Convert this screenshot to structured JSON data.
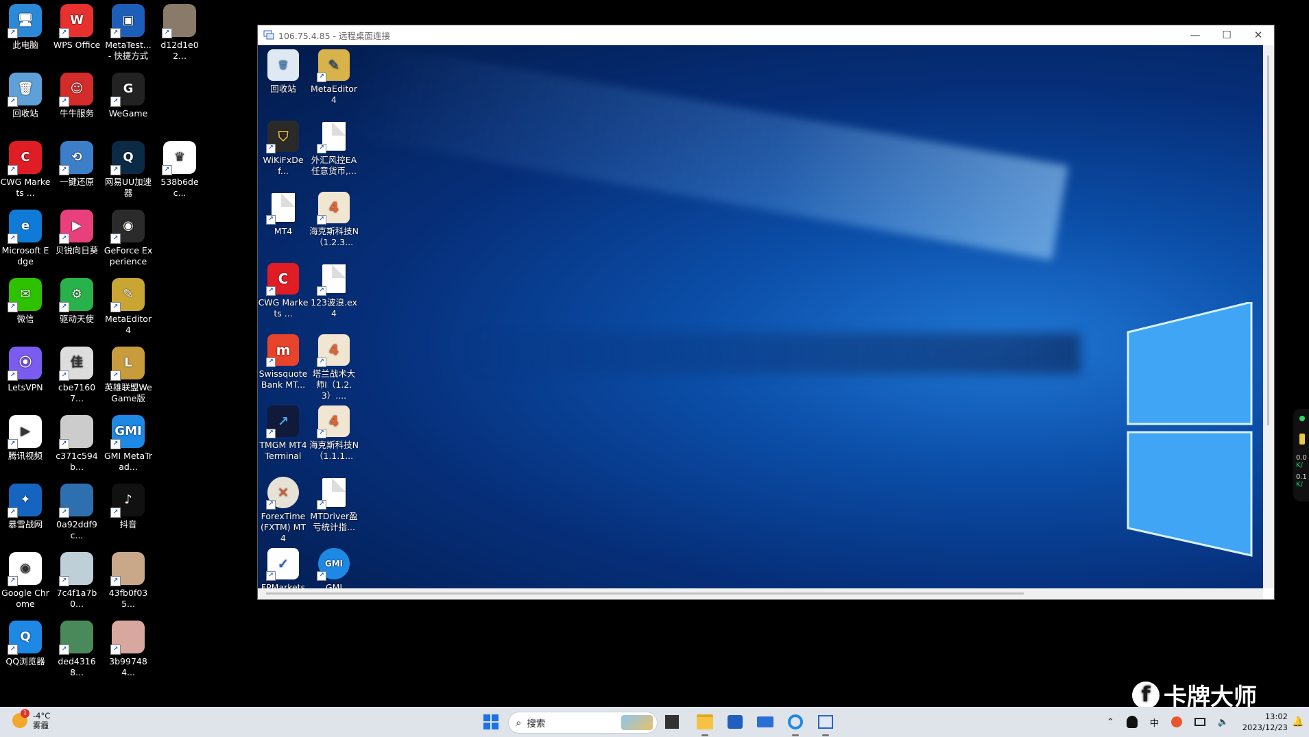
{
  "desktop": {
    "icons": [
      {
        "label": "此电脑",
        "color": "#2a8ad8",
        "glyph": "🖥"
      },
      {
        "label": "WPS Office",
        "color": "#e8302e",
        "glyph": "W"
      },
      {
        "label": "MetaTest... - 快捷方式",
        "color": "#1d5fb8",
        "glyph": "▣"
      },
      {
        "label": "d12d1e02...",
        "color": "#8a7a6a",
        "glyph": ""
      },
      {
        "label": "回收站",
        "color": "#5fa0d8",
        "glyph": "🗑"
      },
      {
        "label": "牛牛服务",
        "color": "#d42b2b",
        "glyph": "☺"
      },
      {
        "label": "WeGame",
        "color": "#222222",
        "glyph": "G"
      },
      {
        "label": "CWG Markets ...",
        "color": "#e01c24",
        "glyph": "C"
      },
      {
        "label": "一键还原",
        "color": "#3c7fc8",
        "glyph": "⟲"
      },
      {
        "label": "网易UU加速器",
        "color": "#0b2a46",
        "glyph": "Q"
      },
      {
        "label": "538b6dec...",
        "color": "#ffffff",
        "glyph": "♛"
      },
      {
        "label": "Microsoft Edge",
        "color": "#0f7bd6",
        "glyph": "e"
      },
      {
        "label": "贝锐向日葵",
        "color": "#e8407c",
        "glyph": "▶"
      },
      {
        "label": "GeForce Experience",
        "color": "#2b2b2b",
        "glyph": "◉"
      },
      {
        "label": "微信",
        "color": "#2dc100",
        "glyph": "✉"
      },
      {
        "label": "驱动天使",
        "color": "#2ab24a",
        "glyph": "⚙"
      },
      {
        "label": "MetaEditor 4",
        "color": "#c9a534",
        "glyph": "✎"
      },
      {
        "label": "LetsVPN",
        "color": "#7b5cf0",
        "glyph": "⦿"
      },
      {
        "label": "cbe71607...",
        "color": "#dddddd",
        "glyph": "佳"
      },
      {
        "label": "英雄联盟WeGame版",
        "color": "#c89b3c",
        "glyph": "L"
      },
      {
        "label": "腾讯视频",
        "color": "#ffffff",
        "glyph": "▶"
      },
      {
        "label": "c371c594b...",
        "color": "#cccccc",
        "glyph": ""
      },
      {
        "label": "GMI MetaTrad...",
        "color": "#1e88e5",
        "glyph": "GMI"
      },
      {
        "label": "暴雪战网",
        "color": "#1565c0",
        "glyph": "✦"
      },
      {
        "label": "0a92ddf9c...",
        "color": "#2e6fb0",
        "glyph": ""
      },
      {
        "label": "抖音",
        "color": "#111111",
        "glyph": "♪"
      },
      {
        "label": "Google Chrome",
        "color": "#ffffff",
        "glyph": "◉"
      },
      {
        "label": "7c4f1a7b0...",
        "color": "#bfcfd8",
        "glyph": ""
      },
      {
        "label": "43fb0f035...",
        "color": "#c9a88a",
        "glyph": ""
      },
      {
        "label": "QQ浏览器",
        "color": "#1e88e5",
        "glyph": "Q"
      },
      {
        "label": "ded43168...",
        "color": "#4a8a5a",
        "glyph": ""
      },
      {
        "label": "3b997484...",
        "color": "#d8a8a0",
        "glyph": ""
      }
    ]
  },
  "rdp": {
    "title": "106.75.4.85 - 远程桌面连接",
    "minimize": "—",
    "maximize": "☐",
    "close": "✕",
    "icons": [
      {
        "label": "回收站",
        "type": "bin"
      },
      {
        "label": "MetaEditor 4",
        "type": "meta"
      },
      {
        "label": "WiKiFxDef...",
        "type": "wiki"
      },
      {
        "label": "外汇风控EA任意货币,...",
        "type": "doc"
      },
      {
        "label": "MT4",
        "type": "doc"
      },
      {
        "label": "海克斯科技N（1.2.3...",
        "type": "ex4"
      },
      {
        "label": "CWG Markets ...",
        "type": "cwg"
      },
      {
        "label": "123波浪.ex4",
        "type": "doc"
      },
      {
        "label": "Swissquote Bank MT...",
        "type": "swiss"
      },
      {
        "label": "塔兰战术大师I（1.2.3）....",
        "type": "ex4"
      },
      {
        "label": "TMGM MT4 Terminal",
        "type": "tmgm"
      },
      {
        "label": "海克斯科技N（1.1.1...",
        "type": "ex4"
      },
      {
        "label": "ForexTime (FXTM) MT4",
        "type": "fxtm"
      },
      {
        "label": "MTDriver盈亏统计指...",
        "type": "doc"
      },
      {
        "label": "FPMarkets",
        "type": "fp"
      },
      {
        "label": "GMI",
        "type": "gmi"
      }
    ]
  },
  "taskbar": {
    "weather": {
      "temp": "-4°C",
      "desc": "雾霾",
      "badge": "1"
    },
    "search_placeholder": "搜索",
    "apps": [
      "start",
      "file-explorer",
      "task-view",
      "store",
      "mail",
      "qq-browser",
      "remote-desktop"
    ],
    "tray": {
      "ime": "中",
      "time": "13:02",
      "date": "2023/12/23"
    }
  },
  "side_widget": {
    "up": "0.0",
    "up_unit": "K/",
    "down": "0.1",
    "down_unit": "K/"
  },
  "watermark": {
    "text": "卡牌大师"
  }
}
